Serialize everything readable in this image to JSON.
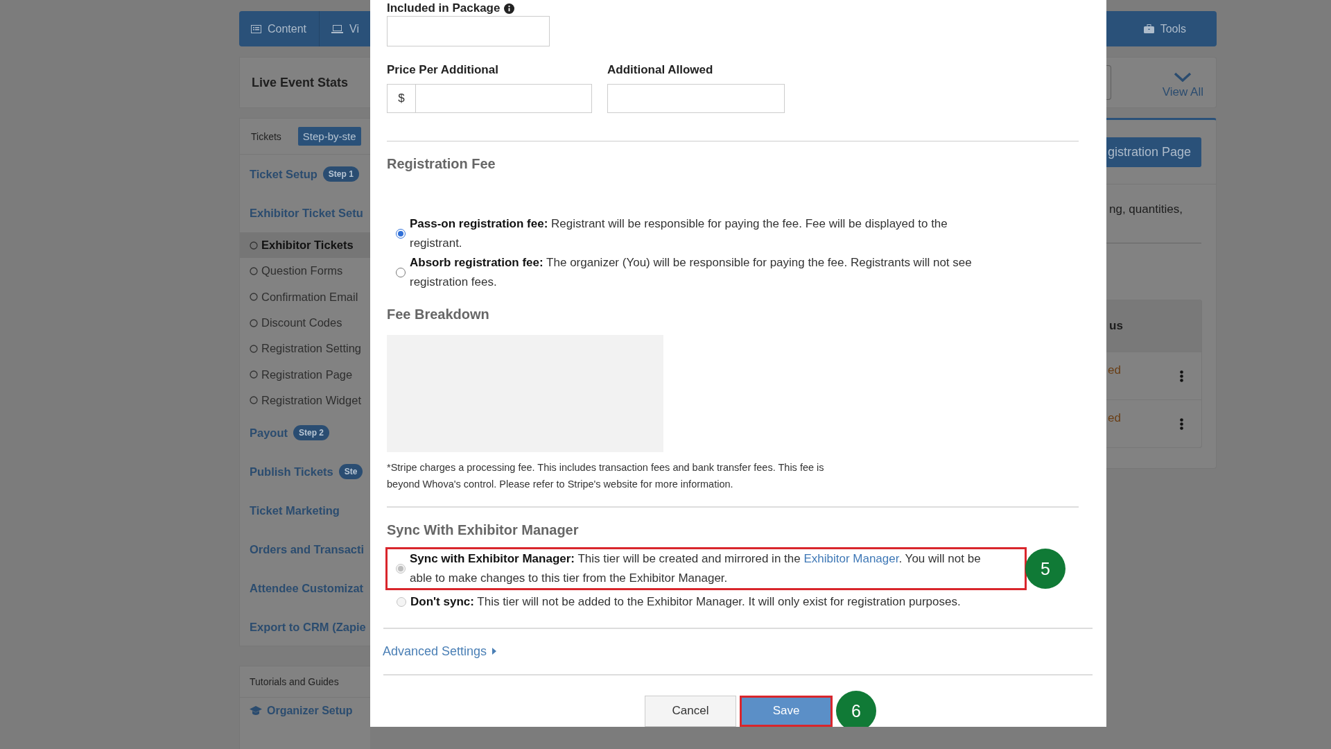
{
  "nav": {
    "tabs": [
      {
        "label": "Content"
      },
      {
        "label": "Vi"
      }
    ],
    "tools": "Tools"
  },
  "stats_card": {
    "title": "Live Event Stats",
    "view_all": "View All"
  },
  "sidebar": {
    "tabs": [
      {
        "label": "Tickets",
        "selected": false
      },
      {
        "label": "Step-by-ste",
        "selected": true
      }
    ],
    "sections": [
      {
        "label": "Ticket Setup",
        "badge": "Step 1"
      },
      {
        "label": "Exhibitor Ticket Setu",
        "children": [
          {
            "label": "Exhibitor Tickets",
            "selected": true
          },
          {
            "label": "Question Forms",
            "selected": false
          },
          {
            "label": "Confirmation Email",
            "selected": false
          },
          {
            "label": "Discount Codes",
            "selected": false
          },
          {
            "label": "Registration Setting",
            "selected": false
          },
          {
            "label": "Registration Page",
            "selected": false
          },
          {
            "label": "Registration Widget",
            "selected": false
          }
        ]
      },
      {
        "label": "Payout",
        "badge": "Step 2"
      },
      {
        "label": "Publish Tickets",
        "badge": "Ste"
      },
      {
        "label": "Ticket Marketing"
      },
      {
        "label": "Orders and Transacti"
      },
      {
        "label": "Attendee Customizat"
      },
      {
        "label": "Export to CRM (Zapie"
      }
    ]
  },
  "tutorials": {
    "title": "Tutorials and Guides",
    "link": "Organizer Setup"
  },
  "right_panel": {
    "button": "gistration Page",
    "text": "ng, quantities,",
    "table": {
      "header": "us",
      "rows": [
        {
          "status": "ed"
        },
        {
          "status": "ed"
        }
      ]
    }
  },
  "modal": {
    "package_field": {
      "label": "Included in Package"
    },
    "price_field": {
      "label": "Price Per Additional",
      "prefix": "$"
    },
    "allowed_field": {
      "label": "Additional Allowed"
    },
    "registration_fee": {
      "heading": "Registration Fee",
      "options": [
        {
          "text": "**Pass-on registration fee:** Registrant will be responsible for paying the fee. Fee will be displayed to the registrant.",
          "selected": true,
          "disabled": false
        },
        {
          "text": "**Absorb registration fee:** The organizer (You) will be responsible for paying the fee. Registrants will not see registration fees.",
          "selected": false,
          "disabled": false
        }
      ]
    },
    "fee_breakdown": {
      "heading": "Fee Breakdown",
      "note": "*Stripe charges a processing fee. This includes transaction fees and bank transfer fees. This fee is beyond Whova's control. Please refer to Stripe's website for more information."
    },
    "sync": {
      "heading": "Sync With Exhibitor Manager",
      "options": [
        {
          "text": "**Sync with Exhibitor Manager:** This tier will be created and mirrored in the ",
          "link": "Exhibitor Manager",
          "text_after": ". You will not be able to make changes to this tier from the Exhibitor Manager.",
          "selected": true,
          "disabled": true,
          "highlighted": true,
          "callout": "5"
        },
        {
          "text": "**Don't sync:** This tier will not be added to the Exhibitor Manager. It will only exist for registration purposes.",
          "selected": false,
          "disabled": true,
          "highlighted": false
        }
      ]
    },
    "advanced_settings": "Advanced Settings",
    "buttons": [
      {
        "label": "Cancel",
        "kind": "secondary",
        "highlighted": false
      },
      {
        "label": "Save",
        "kind": "primary",
        "highlighted": true,
        "callout": "6"
      }
    ]
  }
}
